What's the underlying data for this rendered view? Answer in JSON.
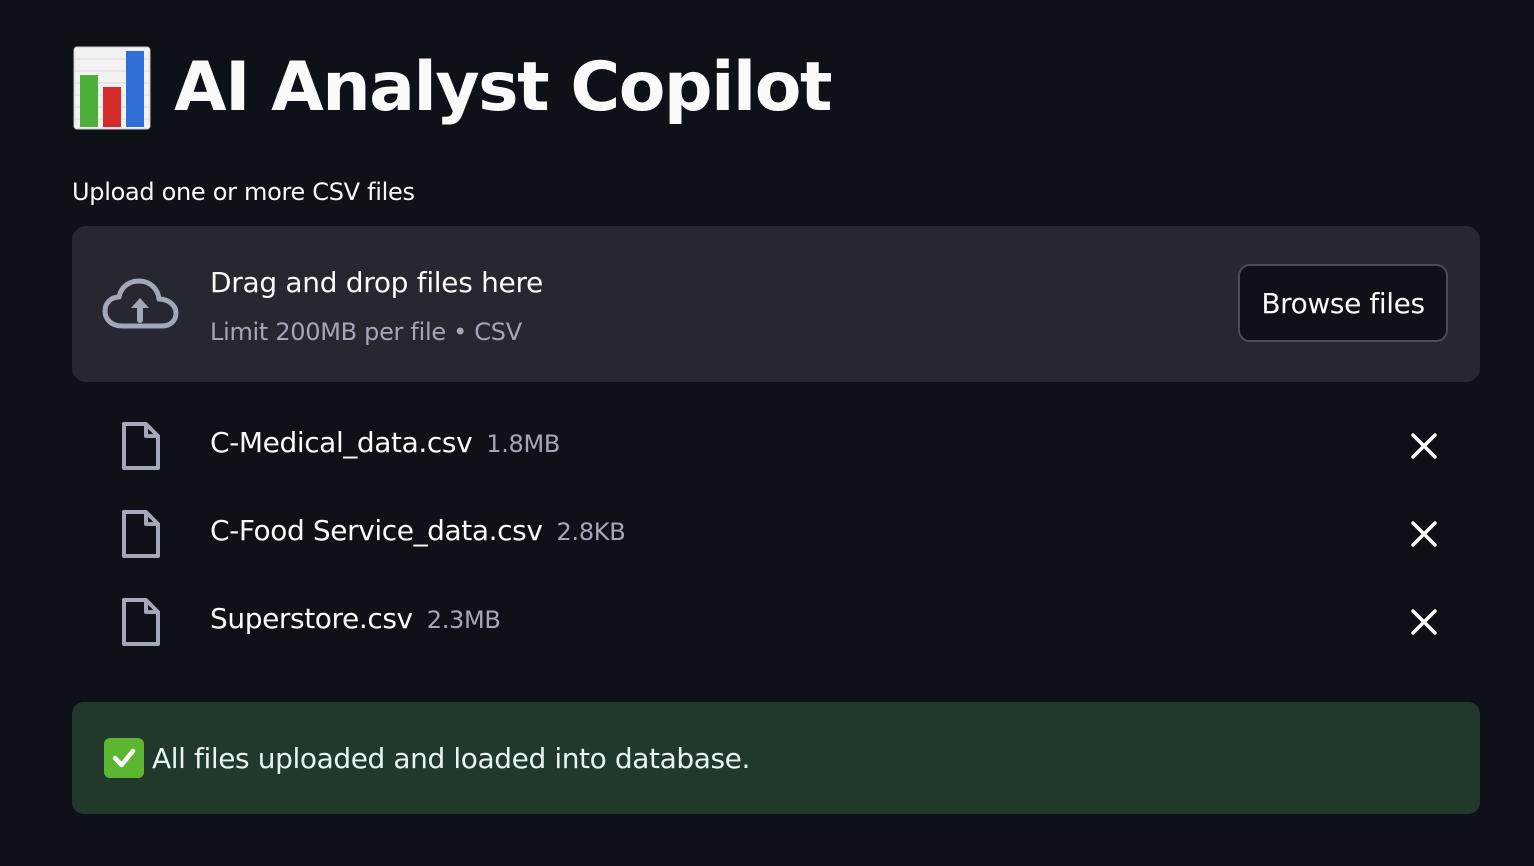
{
  "header": {
    "title": "AI Analyst Copilot",
    "title_icon": "bar-chart-emoji-icon"
  },
  "uploader": {
    "label": "Upload one or more CSV files",
    "dropzone_title": "Drag and drop files here",
    "dropzone_limit": "Limit 200MB per file • CSV",
    "browse_label": "Browse files",
    "upload_icon": "cloud-upload-icon"
  },
  "files": [
    {
      "name": "C-Medical_data.csv",
      "size": "1.8MB"
    },
    {
      "name": "C-Food Service_data.csv",
      "size": "2.8KB"
    },
    {
      "name": "Superstore.csv",
      "size": "2.3MB"
    }
  ],
  "status": {
    "message": "All files uploaded and loaded into database.",
    "icon": "check-mark-emoji-icon",
    "color": "#21392b"
  },
  "colors": {
    "background": "#0e1117",
    "surface": "#262730",
    "muted_text": "#a3a8b8",
    "success_bg": "#21392b",
    "check_green": "#5cb630"
  }
}
